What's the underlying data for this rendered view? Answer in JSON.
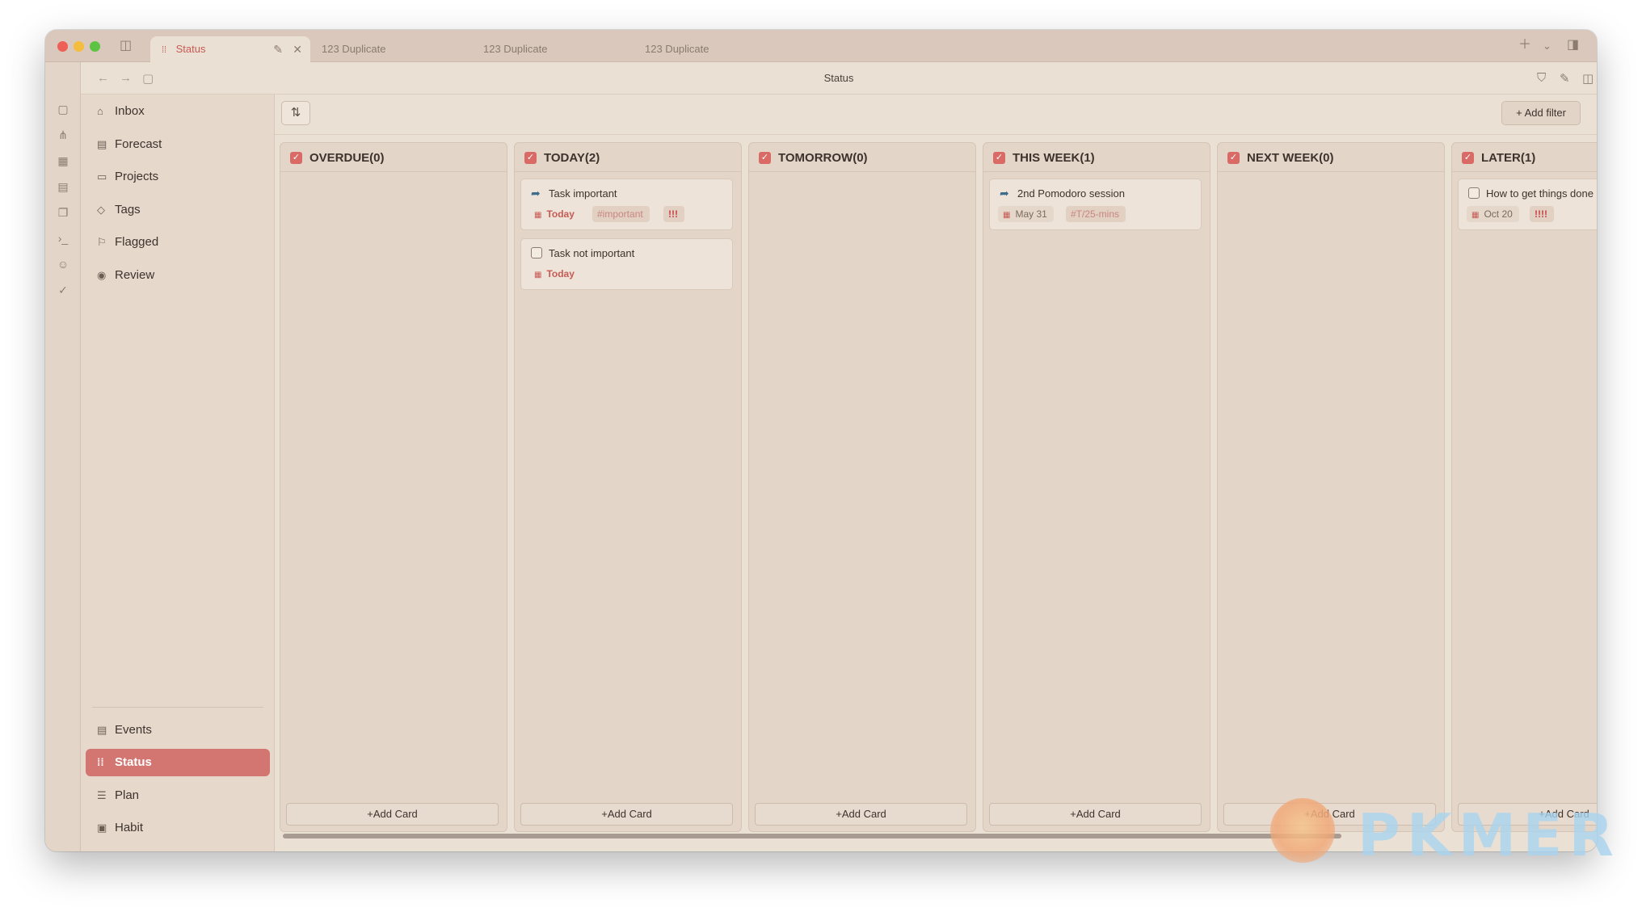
{
  "tabs": [
    {
      "label": "Status",
      "active": true
    },
    {
      "label": "123 Duplicate"
    },
    {
      "label": "123 Duplicate"
    },
    {
      "label": "123 Duplicate"
    }
  ],
  "nav": {
    "page_title": "Status"
  },
  "sidebar": {
    "top_items": [
      {
        "label": "Inbox",
        "icon": "inbox-icon"
      },
      {
        "label": "Forecast",
        "icon": "calendar-icon"
      },
      {
        "label": "Projects",
        "icon": "folder-icon"
      },
      {
        "label": "Tags",
        "icon": "tag-icon"
      },
      {
        "label": "Flagged",
        "icon": "flag-icon"
      },
      {
        "label": "Review",
        "icon": "eye-icon"
      }
    ],
    "bottom_items": [
      {
        "label": "Events",
        "icon": "calendar-icon"
      },
      {
        "label": "Status",
        "icon": "kanban-icon",
        "active": true
      },
      {
        "label": "Plan",
        "icon": "timeline-icon"
      },
      {
        "label": "Habit",
        "icon": "habit-icon"
      }
    ]
  },
  "toolbar": {
    "add_filter_label": "Add filter",
    "add_filter_plus": "+"
  },
  "columns": [
    {
      "title": "OVERDUE(0)",
      "cards": []
    },
    {
      "title": "TODAY(2)",
      "cards": [
        {
          "title": "Task important",
          "lead": "arrow",
          "date": "Today",
          "date_today": true,
          "tag": "#important",
          "priority": "!!!"
        },
        {
          "title": "Task not important",
          "lead": "checkbox",
          "date": "Today",
          "date_today": true
        }
      ]
    },
    {
      "title": "TOMORROW(0)",
      "cards": []
    },
    {
      "title": "THIS WEEK(1)",
      "cards": [
        {
          "title": "2nd Pomodoro session",
          "lead": "arrow",
          "date": "May 31",
          "tag": "#T/25-mins"
        }
      ]
    },
    {
      "title": "NEXT WEEK(0)",
      "cards": []
    },
    {
      "title": "LATER(1)",
      "cards": [
        {
          "title": "How to get things done",
          "lead": "checkbox",
          "date": "Oct 20",
          "priority": "!!!!"
        }
      ]
    }
  ],
  "add_card_label": "Add Card",
  "add_card_plus": "+",
  "watermark": {
    "text": "PKMER"
  },
  "colors": {
    "accent": "#d37571",
    "priority": "#c6464a",
    "tag": "#c98580"
  }
}
